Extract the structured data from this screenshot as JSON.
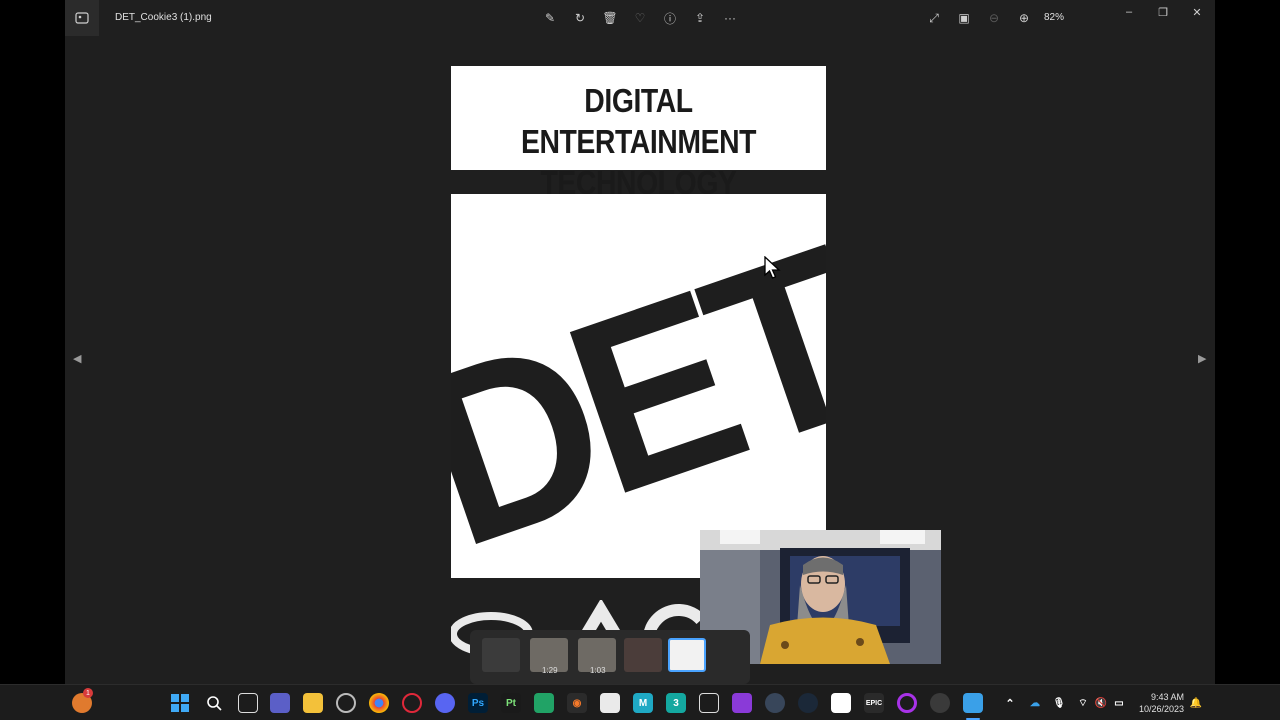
{
  "window": {
    "filename": "DET_Cookie3 (1).png",
    "zoom": "82%"
  },
  "image": {
    "title_line1": "DIGITAL ENTERTAINMENT",
    "title_line2": "TECHNOLOGY",
    "logo_text": "DET"
  },
  "preview": {
    "thumb1_time": "1:29",
    "thumb2_time": "1:03"
  },
  "tray": {
    "time": "9:43 AM",
    "date": "10/26/2023"
  },
  "taskbar": {
    "photoshop_label": "Ps",
    "pycharm_label": "Pt",
    "epic_label": "EPIC",
    "notification_count": "1"
  },
  "colors": {
    "accent": "#4aa3ff",
    "bg": "#1f1f1f"
  }
}
